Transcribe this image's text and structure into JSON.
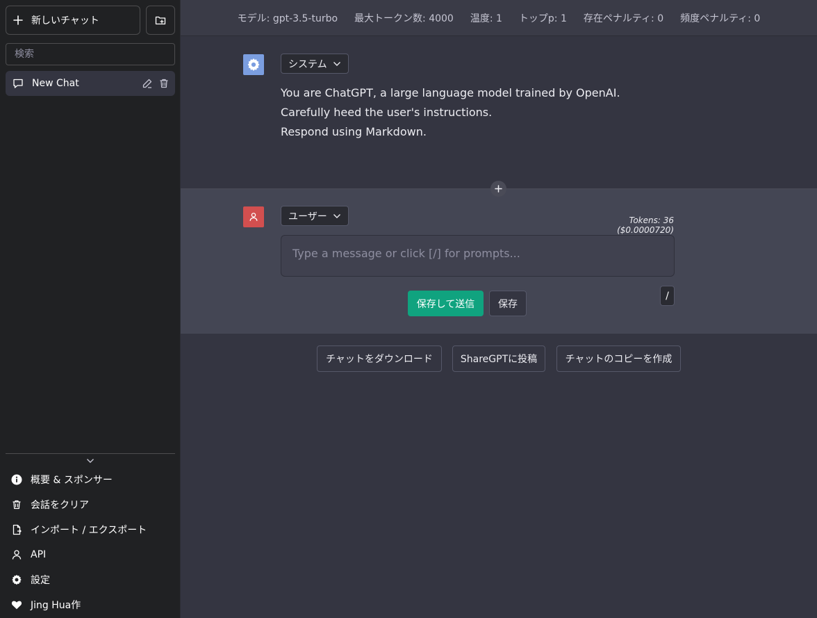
{
  "sidebar": {
    "new_chat_label": "新しいチャット",
    "search_placeholder": "検索",
    "chats": [
      {
        "label": "New Chat"
      }
    ],
    "menu": [
      {
        "label": "概要 & スポンサー",
        "icon": "info-icon"
      },
      {
        "label": "会話をクリア",
        "icon": "trash-icon"
      },
      {
        "label": "インポート / エクスポート",
        "icon": "file-export-icon"
      },
      {
        "label": "API",
        "icon": "person-icon"
      },
      {
        "label": "設定",
        "icon": "gear-icon"
      },
      {
        "label": "Jing Hua作",
        "icon": "heart-icon"
      }
    ]
  },
  "topbar": {
    "model": "モデル: gpt-3.5-turbo",
    "max_tokens": "最大トークン数: 4000",
    "temperature": "温度: 1",
    "top_p": "トップp: 1",
    "presence_penalty": "存在ペナルティ: 0",
    "frequency_penalty": "頻度ペナルティ: 0"
  },
  "system_message": {
    "role_label": "システム",
    "lines": [
      "You are ChatGPT, a large language model trained by OpenAI.",
      "Carefully heed the user's instructions.",
      "Respond using Markdown."
    ]
  },
  "user_message": {
    "role_label": "ユーザー",
    "tokens_label": "Tokens: 36 ($0.0000720)",
    "input_placeholder": "Type a message or click [/] for prompts...",
    "save_send_label": "保存して送信",
    "save_label": "保存",
    "prompt_label": "/"
  },
  "bottom_actions": {
    "download_label": "チャットをダウンロード",
    "share_label": "ShareGPTに投稿",
    "copy_label": "チャットのコピーを作成"
  },
  "colors": {
    "sidebar_bg": "#202123",
    "main_bg": "#343541",
    "user_block_bg": "#444654",
    "system_avatar": "#7b9ee0",
    "user_avatar": "#d24f4f",
    "accent_green": "#10a37f"
  }
}
